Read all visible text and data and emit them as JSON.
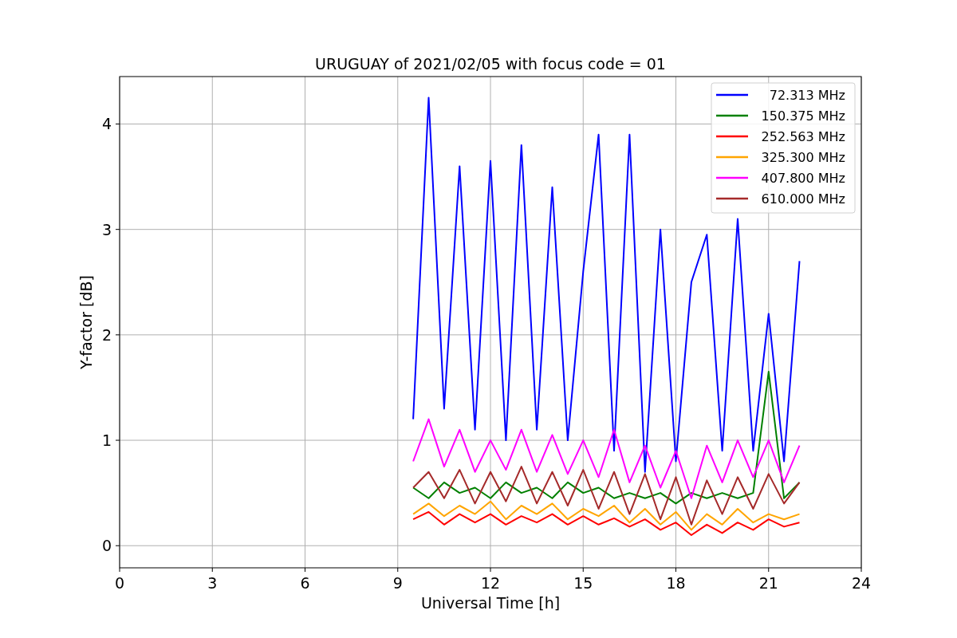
{
  "figure": {
    "chart_data": {
      "type": "line",
      "title": "URUGUAY of 2021/02/05 with focus code = 01",
      "xlabel": "Universal Time [h]",
      "ylabel": "Y-factor [dB]",
      "x": [
        9.5,
        10,
        10.5,
        11,
        11.5,
        12,
        12.5,
        13,
        13.5,
        14,
        14.5,
        15,
        15.5,
        16,
        16.5,
        17,
        17.5,
        18,
        18.5,
        19,
        19.5,
        20,
        20.5,
        21,
        21.5,
        22
      ],
      "series": [
        {
          "name": " 72.313 MHz",
          "color": "#0000ff",
          "values": [
            1.2,
            4.25,
            1.3,
            3.6,
            1.1,
            3.65,
            1.0,
            3.8,
            1.1,
            3.4,
            1.0,
            2.6,
            3.9,
            0.9,
            3.9,
            0.7,
            3.0,
            0.8,
            2.5,
            2.95,
            0.9,
            3.1,
            0.9,
            2.2,
            0.8,
            2.7
          ]
        },
        {
          "name": "150.375 MHz",
          "color": "#008000",
          "values": [
            0.55,
            0.45,
            0.6,
            0.5,
            0.55,
            0.45,
            0.6,
            0.5,
            0.55,
            0.45,
            0.6,
            0.5,
            0.55,
            0.45,
            0.5,
            0.45,
            0.5,
            0.4,
            0.5,
            0.45,
            0.5,
            0.45,
            0.5,
            1.65,
            0.45,
            0.6
          ]
        },
        {
          "name": "252.563 MHz",
          "color": "#ff0000",
          "values": [
            0.25,
            0.32,
            0.2,
            0.3,
            0.22,
            0.3,
            0.2,
            0.28,
            0.22,
            0.3,
            0.2,
            0.28,
            0.2,
            0.26,
            0.18,
            0.25,
            0.15,
            0.22,
            0.1,
            0.2,
            0.12,
            0.22,
            0.15,
            0.25,
            0.18,
            0.22
          ]
        },
        {
          "name": "325.300 MHz",
          "color": "#ffa500",
          "values": [
            0.3,
            0.4,
            0.28,
            0.38,
            0.3,
            0.42,
            0.25,
            0.38,
            0.3,
            0.4,
            0.25,
            0.35,
            0.28,
            0.38,
            0.22,
            0.35,
            0.2,
            0.32,
            0.15,
            0.3,
            0.2,
            0.35,
            0.22,
            0.3,
            0.25,
            0.3
          ]
        },
        {
          "name": "407.800 MHz",
          "color": "#ff00ff",
          "values": [
            0.8,
            1.2,
            0.75,
            1.1,
            0.7,
            1.0,
            0.72,
            1.1,
            0.7,
            1.05,
            0.68,
            1.0,
            0.65,
            1.1,
            0.6,
            0.95,
            0.55,
            0.9,
            0.45,
            0.95,
            0.6,
            1.0,
            0.65,
            1.0,
            0.6,
            0.95
          ]
        },
        {
          "name": "610.000 MHz",
          "color": "#a52a2a",
          "values": [
            0.55,
            0.7,
            0.45,
            0.72,
            0.4,
            0.7,
            0.42,
            0.75,
            0.4,
            0.7,
            0.38,
            0.72,
            0.35,
            0.7,
            0.3,
            0.68,
            0.25,
            0.65,
            0.2,
            0.62,
            0.3,
            0.65,
            0.35,
            0.68,
            0.4,
            0.6
          ]
        }
      ],
      "xlim": [
        0,
        24
      ],
      "ylim": [
        -0.21,
        4.45
      ],
      "xticks": [
        0,
        3,
        6,
        9,
        12,
        15,
        18,
        21,
        24
      ],
      "yticks": [
        0,
        1,
        2,
        3,
        4
      ],
      "grid": true,
      "legend": "upper right"
    }
  }
}
